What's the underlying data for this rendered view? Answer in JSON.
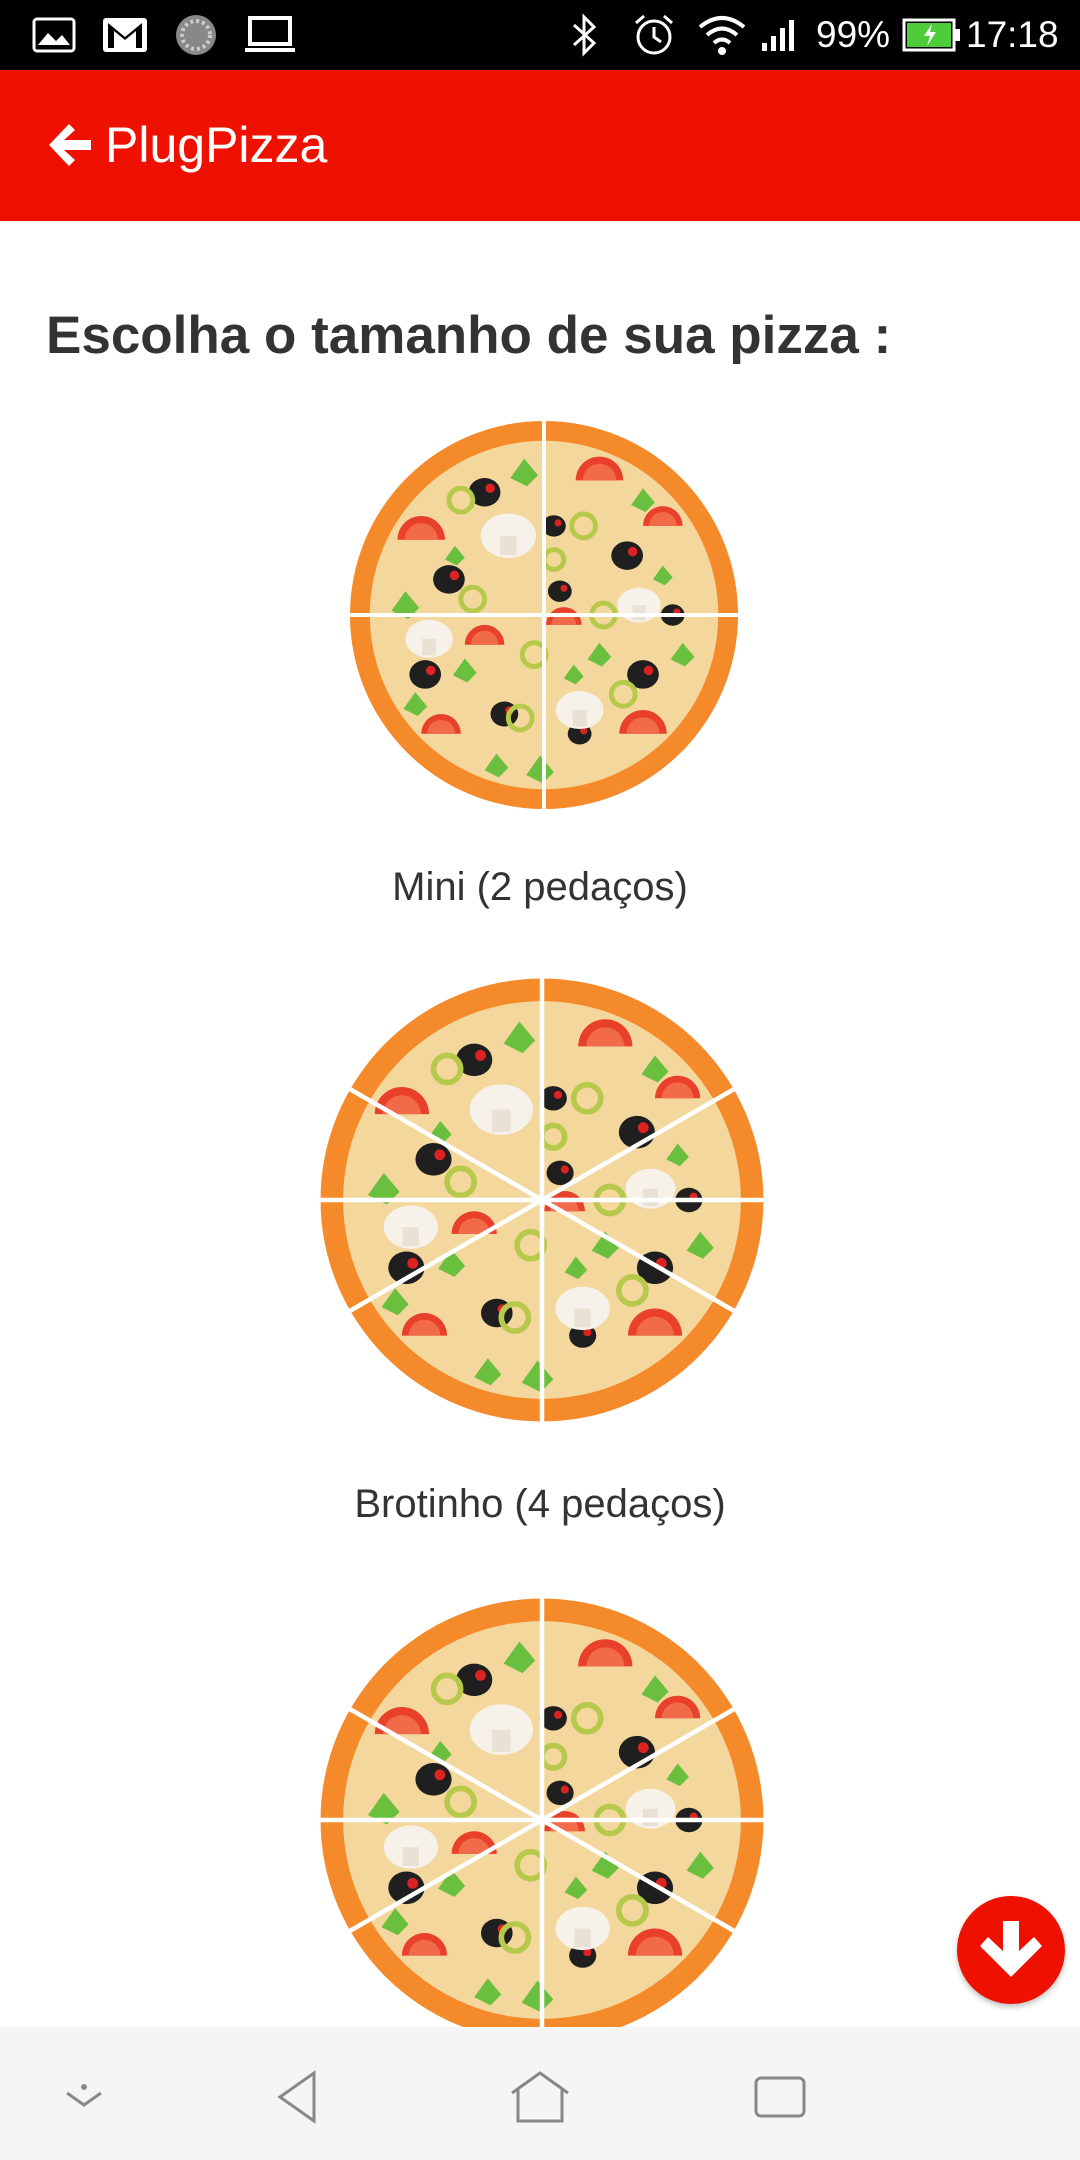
{
  "status_bar": {
    "battery_text": "99%",
    "time": "17:18",
    "left_icons": [
      "gallery-icon",
      "gmail-icon",
      "sync-icon",
      "laptop-icon"
    ],
    "right_icons": [
      "bluetooth-icon",
      "alarm-icon",
      "wifi-icon",
      "signal-icon",
      "battery-icon"
    ]
  },
  "app_bar": {
    "title": "PlugPizza",
    "background_color": "#ee1100"
  },
  "main": {
    "heading": "Escolha o tamanho de sua pizza :",
    "options": [
      {
        "label": "Mini (2 pedaços)",
        "slices": 4
      },
      {
        "label": "Brotinho (4 pedaços)",
        "slices": 6
      },
      {
        "label": "",
        "slices": 6
      }
    ]
  },
  "fab": {
    "icon": "arrow-down-icon"
  },
  "nav_bar": {
    "icons": [
      "notification-pull-icon",
      "back-icon",
      "home-icon",
      "recents-icon"
    ]
  },
  "colors": {
    "accent": "#ee1100",
    "pizza_crust": "#f58a2b",
    "pizza_cheese": "#f4d79c",
    "text_dark": "#333333"
  }
}
